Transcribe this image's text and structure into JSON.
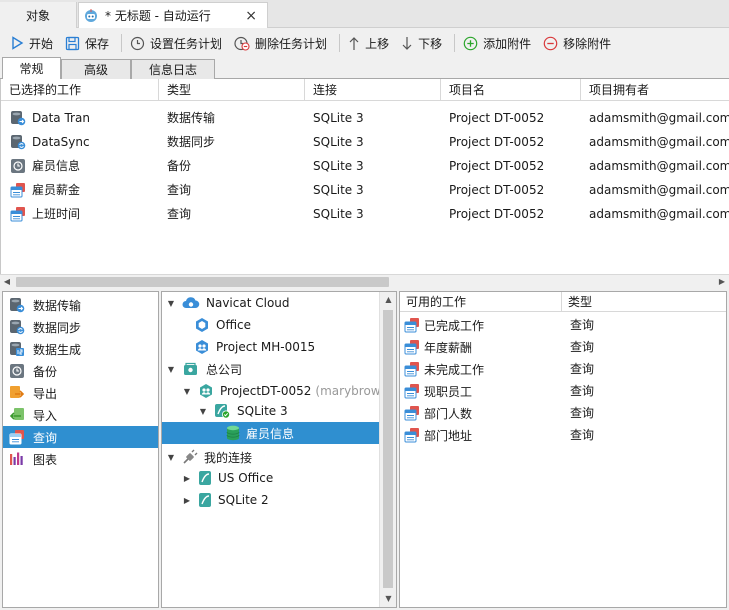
{
  "tabs": {
    "objects": "对象",
    "automation": "* 无标题 - 自动运行",
    "close": "×"
  },
  "toolbar": {
    "start": "开始",
    "save": "保存",
    "set_schedule": "设置任务计划",
    "delete_schedule": "删除任务计划",
    "move_up": "上移",
    "move_down": "下移",
    "add_attachment": "添加附件",
    "remove_attachment": "移除附件"
  },
  "subtabs": [
    "常规",
    "高级",
    "信息日志"
  ],
  "jobs": {
    "columns": [
      "已选择的工作",
      "类型",
      "连接",
      "项目名",
      "项目拥有者"
    ],
    "rows": [
      {
        "name": "Data Tran",
        "type": "数据传输",
        "connection": "SQLite 3",
        "project": "Project DT-0052",
        "owner": "adamsmith@gmail.com",
        "icon": "data-transfer"
      },
      {
        "name": "DataSync",
        "type": "数据同步",
        "connection": "SQLite 3",
        "project": "Project DT-0052",
        "owner": "adamsmith@gmail.com",
        "icon": "data-sync"
      },
      {
        "name": "雇员信息",
        "type": "备份",
        "connection": "SQLite 3",
        "project": "Project DT-0052",
        "owner": "adamsmith@gmail.com",
        "icon": "backup"
      },
      {
        "name": "雇员薪金",
        "type": "查询",
        "connection": "SQLite 3",
        "project": "Project DT-0052",
        "owner": "adamsmith@gmail.com",
        "icon": "query"
      },
      {
        "name": "上班时间",
        "type": "查询",
        "connection": "SQLite 3",
        "project": "Project DT-0052",
        "owner": "adamsmith@gmail.com",
        "icon": "query"
      }
    ]
  },
  "job_types": [
    {
      "label": "数据传输",
      "icon": "data-transfer"
    },
    {
      "label": "数据同步",
      "icon": "data-sync"
    },
    {
      "label": "数据生成",
      "icon": "data-generation"
    },
    {
      "label": "备份",
      "icon": "backup"
    },
    {
      "label": "导出",
      "icon": "export"
    },
    {
      "label": "导入",
      "icon": "import"
    },
    {
      "label": "查询",
      "icon": "query",
      "selected": true
    },
    {
      "label": "图表",
      "icon": "chart"
    }
  ],
  "tree": {
    "navicat_cloud": "Navicat Cloud",
    "office": "Office",
    "project_mh": "Project MH-0015",
    "hq": "总公司",
    "project_dt": "ProjectDT-0052",
    "project_dt_owner": "(marybrown",
    "sqlite3": "SQLite 3",
    "employee_info": "雇员信息",
    "my_connections": "我的连接",
    "us_office": "US Office",
    "sqlite2": "SQLite 2"
  },
  "available": {
    "columns": [
      "可用的工作",
      "类型"
    ],
    "rows": [
      {
        "name": "已完成工作",
        "type": "查询"
      },
      {
        "name": "年度薪酬",
        "type": "查询"
      },
      {
        "name": "未完成工作",
        "type": "查询"
      },
      {
        "name": "现职员工",
        "type": "查询"
      },
      {
        "name": "部门人数",
        "type": "查询"
      },
      {
        "name": "部门地址",
        "type": "查询"
      }
    ]
  },
  "colors": {
    "selection": "#2f8fd0",
    "accent_blue": "#2a7fd4",
    "add_green": "#2aa52a",
    "remove_red": "#d9383a",
    "query_red": "#e0554e"
  }
}
